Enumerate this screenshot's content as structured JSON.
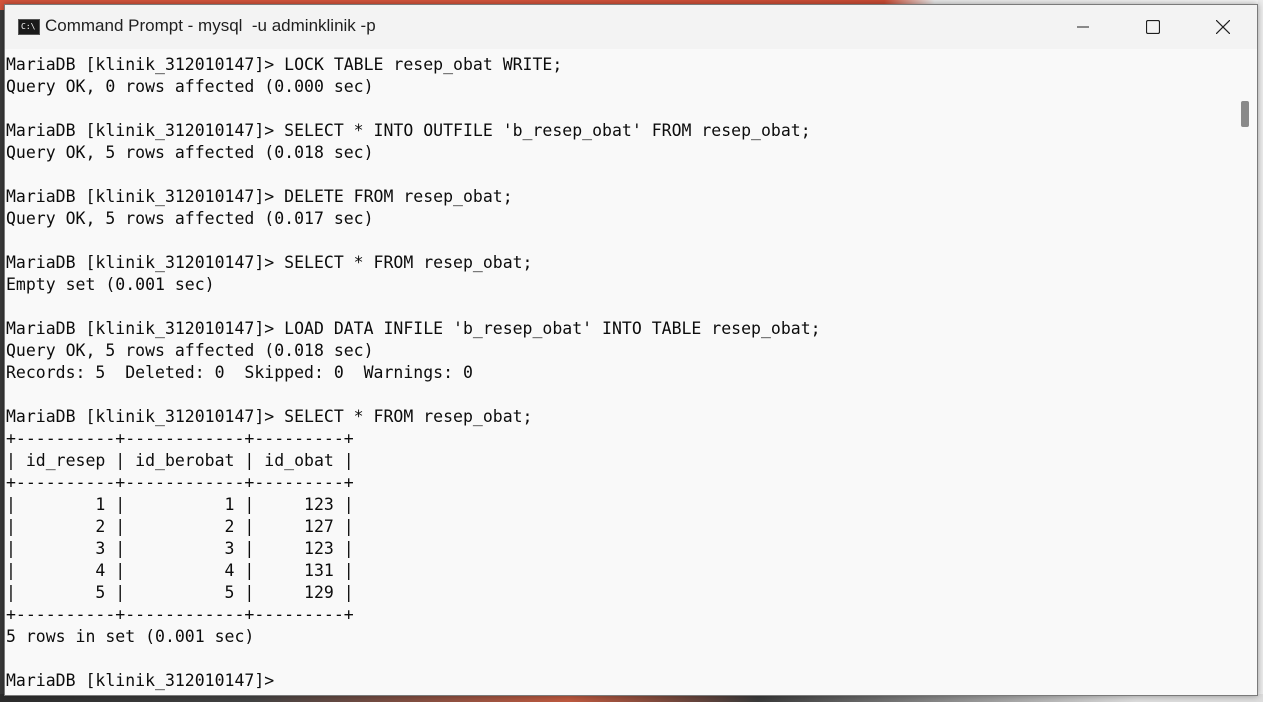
{
  "window": {
    "title": "Command Prompt - mysql  -u adminklinik -p",
    "icon_text": "C:\\",
    "icon": "cmd-icon",
    "controls": {
      "minimize": "minimize-icon",
      "maximize": "maximize-icon",
      "close": "close-icon"
    }
  },
  "terminal": {
    "lines": [
      "MariaDB [klinik_312010147]> LOCK TABLE resep_obat WRITE;",
      "Query OK, 0 rows affected (0.000 sec)",
      "",
      "MariaDB [klinik_312010147]> SELECT * INTO OUTFILE 'b_resep_obat' FROM resep_obat;",
      "Query OK, 5 rows affected (0.018 sec)",
      "",
      "MariaDB [klinik_312010147]> DELETE FROM resep_obat;",
      "Query OK, 5 rows affected (0.017 sec)",
      "",
      "MariaDB [klinik_312010147]> SELECT * FROM resep_obat;",
      "Empty set (0.001 sec)",
      "",
      "MariaDB [klinik_312010147]> LOAD DATA INFILE 'b_resep_obat' INTO TABLE resep_obat;",
      "Query OK, 5 rows affected (0.018 sec)",
      "Records: 5  Deleted: 0  Skipped: 0  Warnings: 0",
      "",
      "MariaDB [klinik_312010147]> SELECT * FROM resep_obat;",
      "+----------+------------+---------+",
      "| id_resep | id_berobat | id_obat |",
      "+----------+------------+---------+",
      "|        1 |          1 |     123 |",
      "|        2 |          2 |     127 |",
      "|        3 |          3 |     123 |",
      "|        4 |          4 |     131 |",
      "|        5 |          5 |     129 |",
      "+----------+------------+---------+",
      "5 rows in set (0.001 sec)",
      "",
      "MariaDB [klinik_312010147]>"
    ]
  },
  "colors": {
    "terminal_bg": "#f9f9f9",
    "terminal_fg": "#0c0c0c",
    "titlebar_bg": "#f3f3f3"
  }
}
